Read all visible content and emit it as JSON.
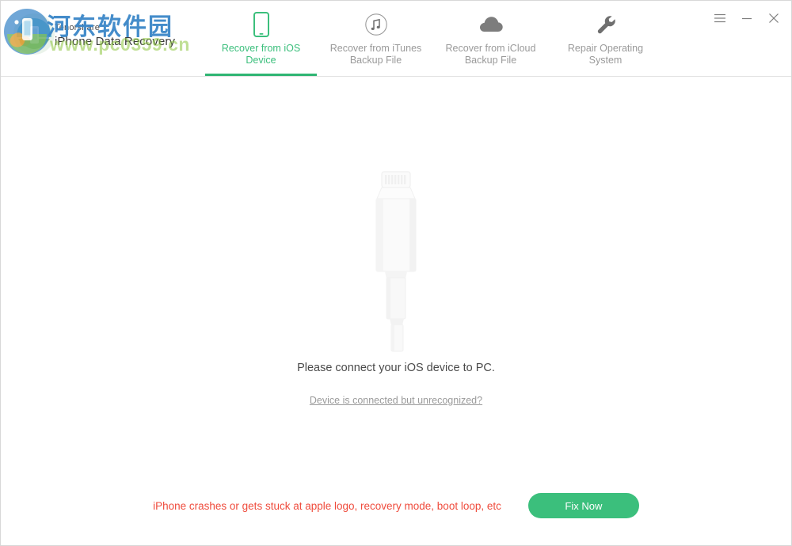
{
  "window": {
    "brand_line1": "Tenorshare",
    "brand_line2": "iPhone Data Recovery",
    "controls": {
      "menu_label": "menu-icon",
      "minimize_label": "minimize-icon",
      "close_label": "close-icon"
    }
  },
  "watermark": {
    "chinese": "河东软件园",
    "url": "www.pc0359.cn"
  },
  "tabs": [
    {
      "label": "Recover from iOS Device",
      "icon": "phone-icon",
      "active": true
    },
    {
      "label": "Recover from iTunes Backup File",
      "icon": "itunes-note-icon",
      "active": false
    },
    {
      "label": "Recover from iCloud Backup File",
      "icon": "cloud-icon",
      "active": false
    },
    {
      "label": "Repair Operating System",
      "icon": "wrench-icon",
      "active": false
    }
  ],
  "main": {
    "illustration": "lightning-cable-illustration",
    "message": "Please connect your iOS device to PC.",
    "unrecognized_link": "Device is connected but unrecognized?"
  },
  "bottom": {
    "crash_note": "iPhone crashes or gets stuck at apple logo, recovery mode, boot loop, etc",
    "fix_button": "Fix Now"
  },
  "colors": {
    "accent_green": "#3bbf7c",
    "accent_green_dark": "#2fb573",
    "alert_red": "#ef4b3c",
    "muted_text": "#9a9a9a",
    "body_text": "#4a4a4a",
    "watermark_blue": "#3a86c8",
    "watermark_green": "#8dc63f"
  }
}
